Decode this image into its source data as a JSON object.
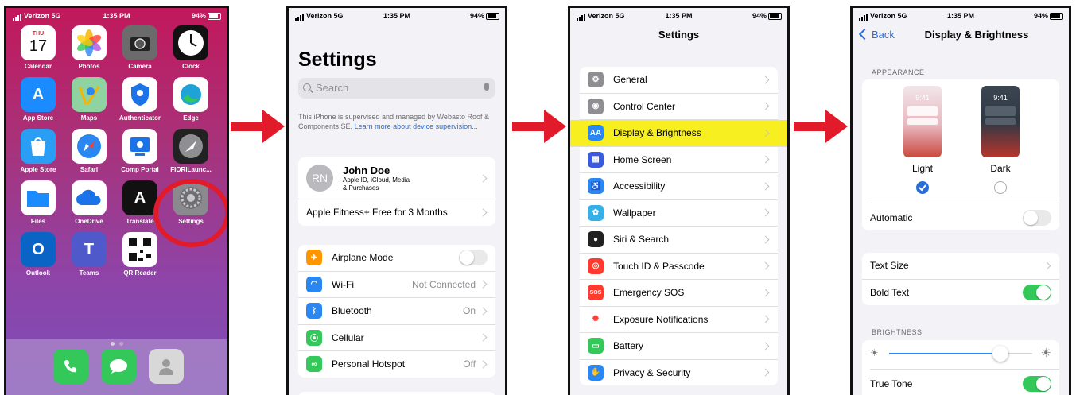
{
  "status": {
    "carrier": "Verizon",
    "network": "5G",
    "time": "1:35 PM",
    "battery": "94%"
  },
  "home": {
    "apps": [
      {
        "label": "Calendar",
        "color": "#ffffff",
        "text": "17",
        "sub": "THU"
      },
      {
        "label": "Photos",
        "color": "#ffffff",
        "text": ""
      },
      {
        "label": "Camera",
        "color": "#6b6b6b",
        "text": ""
      },
      {
        "label": "Clock",
        "color": "#111111",
        "text": ""
      },
      {
        "label": "App Store",
        "color": "#1a8cff",
        "text": "A"
      },
      {
        "label": "Maps",
        "color": "#8fd3a0",
        "text": ""
      },
      {
        "label": "Authenticator",
        "color": "#ffffff",
        "text": ""
      },
      {
        "label": "Edge",
        "color": "#ffffff",
        "text": ""
      },
      {
        "label": "Apple Store",
        "color": "#2a9df4",
        "text": ""
      },
      {
        "label": "Safari",
        "color": "#ffffff",
        "text": ""
      },
      {
        "label": "Comp Portal",
        "color": "#ffffff",
        "text": ""
      },
      {
        "label": "FIORILaunc...",
        "color": "#222222",
        "text": ""
      },
      {
        "label": "Files",
        "color": "#ffffff",
        "text": ""
      },
      {
        "label": "OneDrive",
        "color": "#ffffff",
        "text": ""
      },
      {
        "label": "Translate",
        "color": "#111111",
        "text": "A"
      },
      {
        "label": "Settings",
        "color": "#8a8a8e",
        "text": ""
      },
      {
        "label": "Outlook",
        "color": "#ffffff",
        "text": "O"
      },
      {
        "label": "Teams",
        "color": "#ffffff",
        "text": "T"
      },
      {
        "label": "QR Reader",
        "color": "#ffffff",
        "text": ""
      }
    ],
    "dock": [
      {
        "name": "phone",
        "color": "#34c759"
      },
      {
        "name": "messages",
        "color": "#34c759"
      },
      {
        "name": "contacts",
        "color": "#d8d8d8"
      }
    ]
  },
  "settings": {
    "title": "Settings",
    "search_placeholder": "Search",
    "note": "This iPhone is supervised and managed by Webasto Roof & Components SE.",
    "note_link": "Learn more about device supervision...",
    "profile": {
      "initials": "RN",
      "name": "John Doe",
      "sub1": "Apple ID, iCloud, Media",
      "sub2": "& Purchases"
    },
    "fitness": "Apple Fitness+ Free for 3 Months",
    "rows": [
      {
        "label": "Airplane Mode",
        "value": "",
        "color": "#ff9500",
        "glyph": "✈",
        "toggle": true
      },
      {
        "label": "Wi-Fi",
        "value": "Not Connected",
        "color": "#2a86f0",
        "glyph": "◠",
        "toggle": false
      },
      {
        "label": "Bluetooth",
        "value": "On",
        "color": "#2a86f0",
        "glyph": "ᛒ",
        "toggle": false
      },
      {
        "label": "Cellular",
        "value": "",
        "color": "#34c759",
        "glyph": "⦿",
        "toggle": false
      },
      {
        "label": "Personal Hotspot",
        "value": "Off",
        "color": "#34c759",
        "glyph": "∞",
        "toggle": false
      }
    ]
  },
  "settings_list": {
    "title": "Settings",
    "rows": [
      {
        "label": "General",
        "color": "#8e8e93",
        "glyph": "⚙"
      },
      {
        "label": "Control Center",
        "color": "#8e8e93",
        "glyph": "◉"
      },
      {
        "label": "Display & Brightness",
        "color": "#2a86f0",
        "glyph": "AA",
        "highlight": true
      },
      {
        "label": "Home Screen",
        "color": "#3a5be0",
        "glyph": "▦"
      },
      {
        "label": "Accessibility",
        "color": "#2a86f0",
        "glyph": "♿"
      },
      {
        "label": "Wallpaper",
        "color": "#35b0e8",
        "glyph": "✿"
      },
      {
        "label": "Siri & Search",
        "color": "#222222",
        "glyph": "●"
      },
      {
        "label": "Touch ID & Passcode",
        "color": "#ff3b30",
        "glyph": "◎"
      },
      {
        "label": "Emergency SOS",
        "color": "#ff3b30",
        "glyph": "SOS"
      },
      {
        "label": "Exposure Notifications",
        "color": "#ffffff",
        "glyph": "✺"
      },
      {
        "label": "Battery",
        "color": "#34c759",
        "glyph": "▭"
      },
      {
        "label": "Privacy & Security",
        "color": "#2a86f0",
        "glyph": "✋"
      }
    ]
  },
  "display": {
    "back": "Back",
    "title": "Display & Brightness",
    "appearance_label": "APPEARANCE",
    "preview_time": "9:41",
    "light": "Light",
    "dark": "Dark",
    "automatic": "Automatic",
    "text_size": "Text Size",
    "bold_text": "Bold Text",
    "brightness_label": "BRIGHTNESS",
    "brightness_level": 0.78,
    "true_tone": "True Tone"
  },
  "accent": "#e21b2b"
}
